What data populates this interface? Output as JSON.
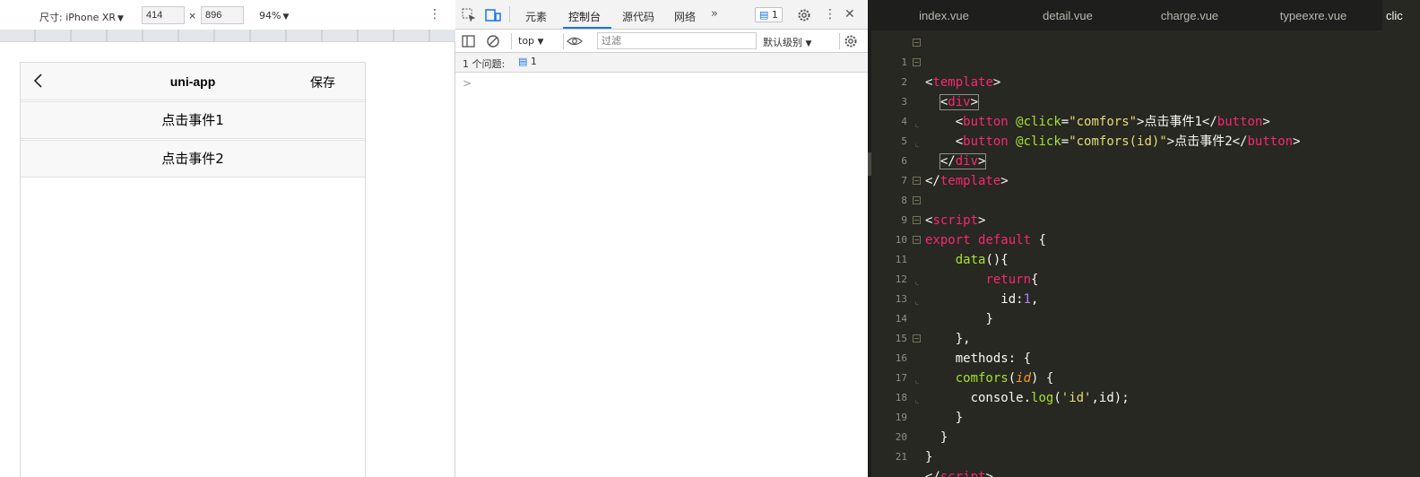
{
  "device_toolbar": {
    "dimensions_label": "尺寸: iPhone XR",
    "width": "414",
    "times": "×",
    "height": "896",
    "zoom": "94%",
    "more": "⋮"
  },
  "phone": {
    "nav_title": "uni-app",
    "nav_right": "保存",
    "buttons": [
      "点击事件1",
      "点击事件2"
    ]
  },
  "devtools": {
    "tabs": [
      "元素",
      "控制台",
      "源代码",
      "网络"
    ],
    "active_tab": "控制台",
    "more_tabs": "»",
    "issues_count": "1",
    "context": "top",
    "filter_placeholder": "过滤",
    "level": "默认级别",
    "issue_bar_text": "1 个问题:",
    "issue_bar_count": "1",
    "prompt": ">"
  },
  "editor": {
    "tabs": [
      "index.vue",
      "detail.vue",
      "charge.vue",
      "typeexre.vue",
      "clic"
    ],
    "active_tab_index": 4,
    "line_numbers": [
      "1",
      "2",
      "3",
      "4",
      "5",
      "6",
      "7",
      "8",
      "9",
      "10",
      "11",
      "12",
      "13",
      "14",
      "15",
      "16",
      "17",
      "18",
      "19",
      "20",
      "21"
    ],
    "colors": {
      "background": "#272822",
      "tag": "#f92672",
      "attribute": "#a6e22e",
      "string": "#e6db74",
      "number": "#ae81ff",
      "parameter": "#fd971f"
    }
  }
}
